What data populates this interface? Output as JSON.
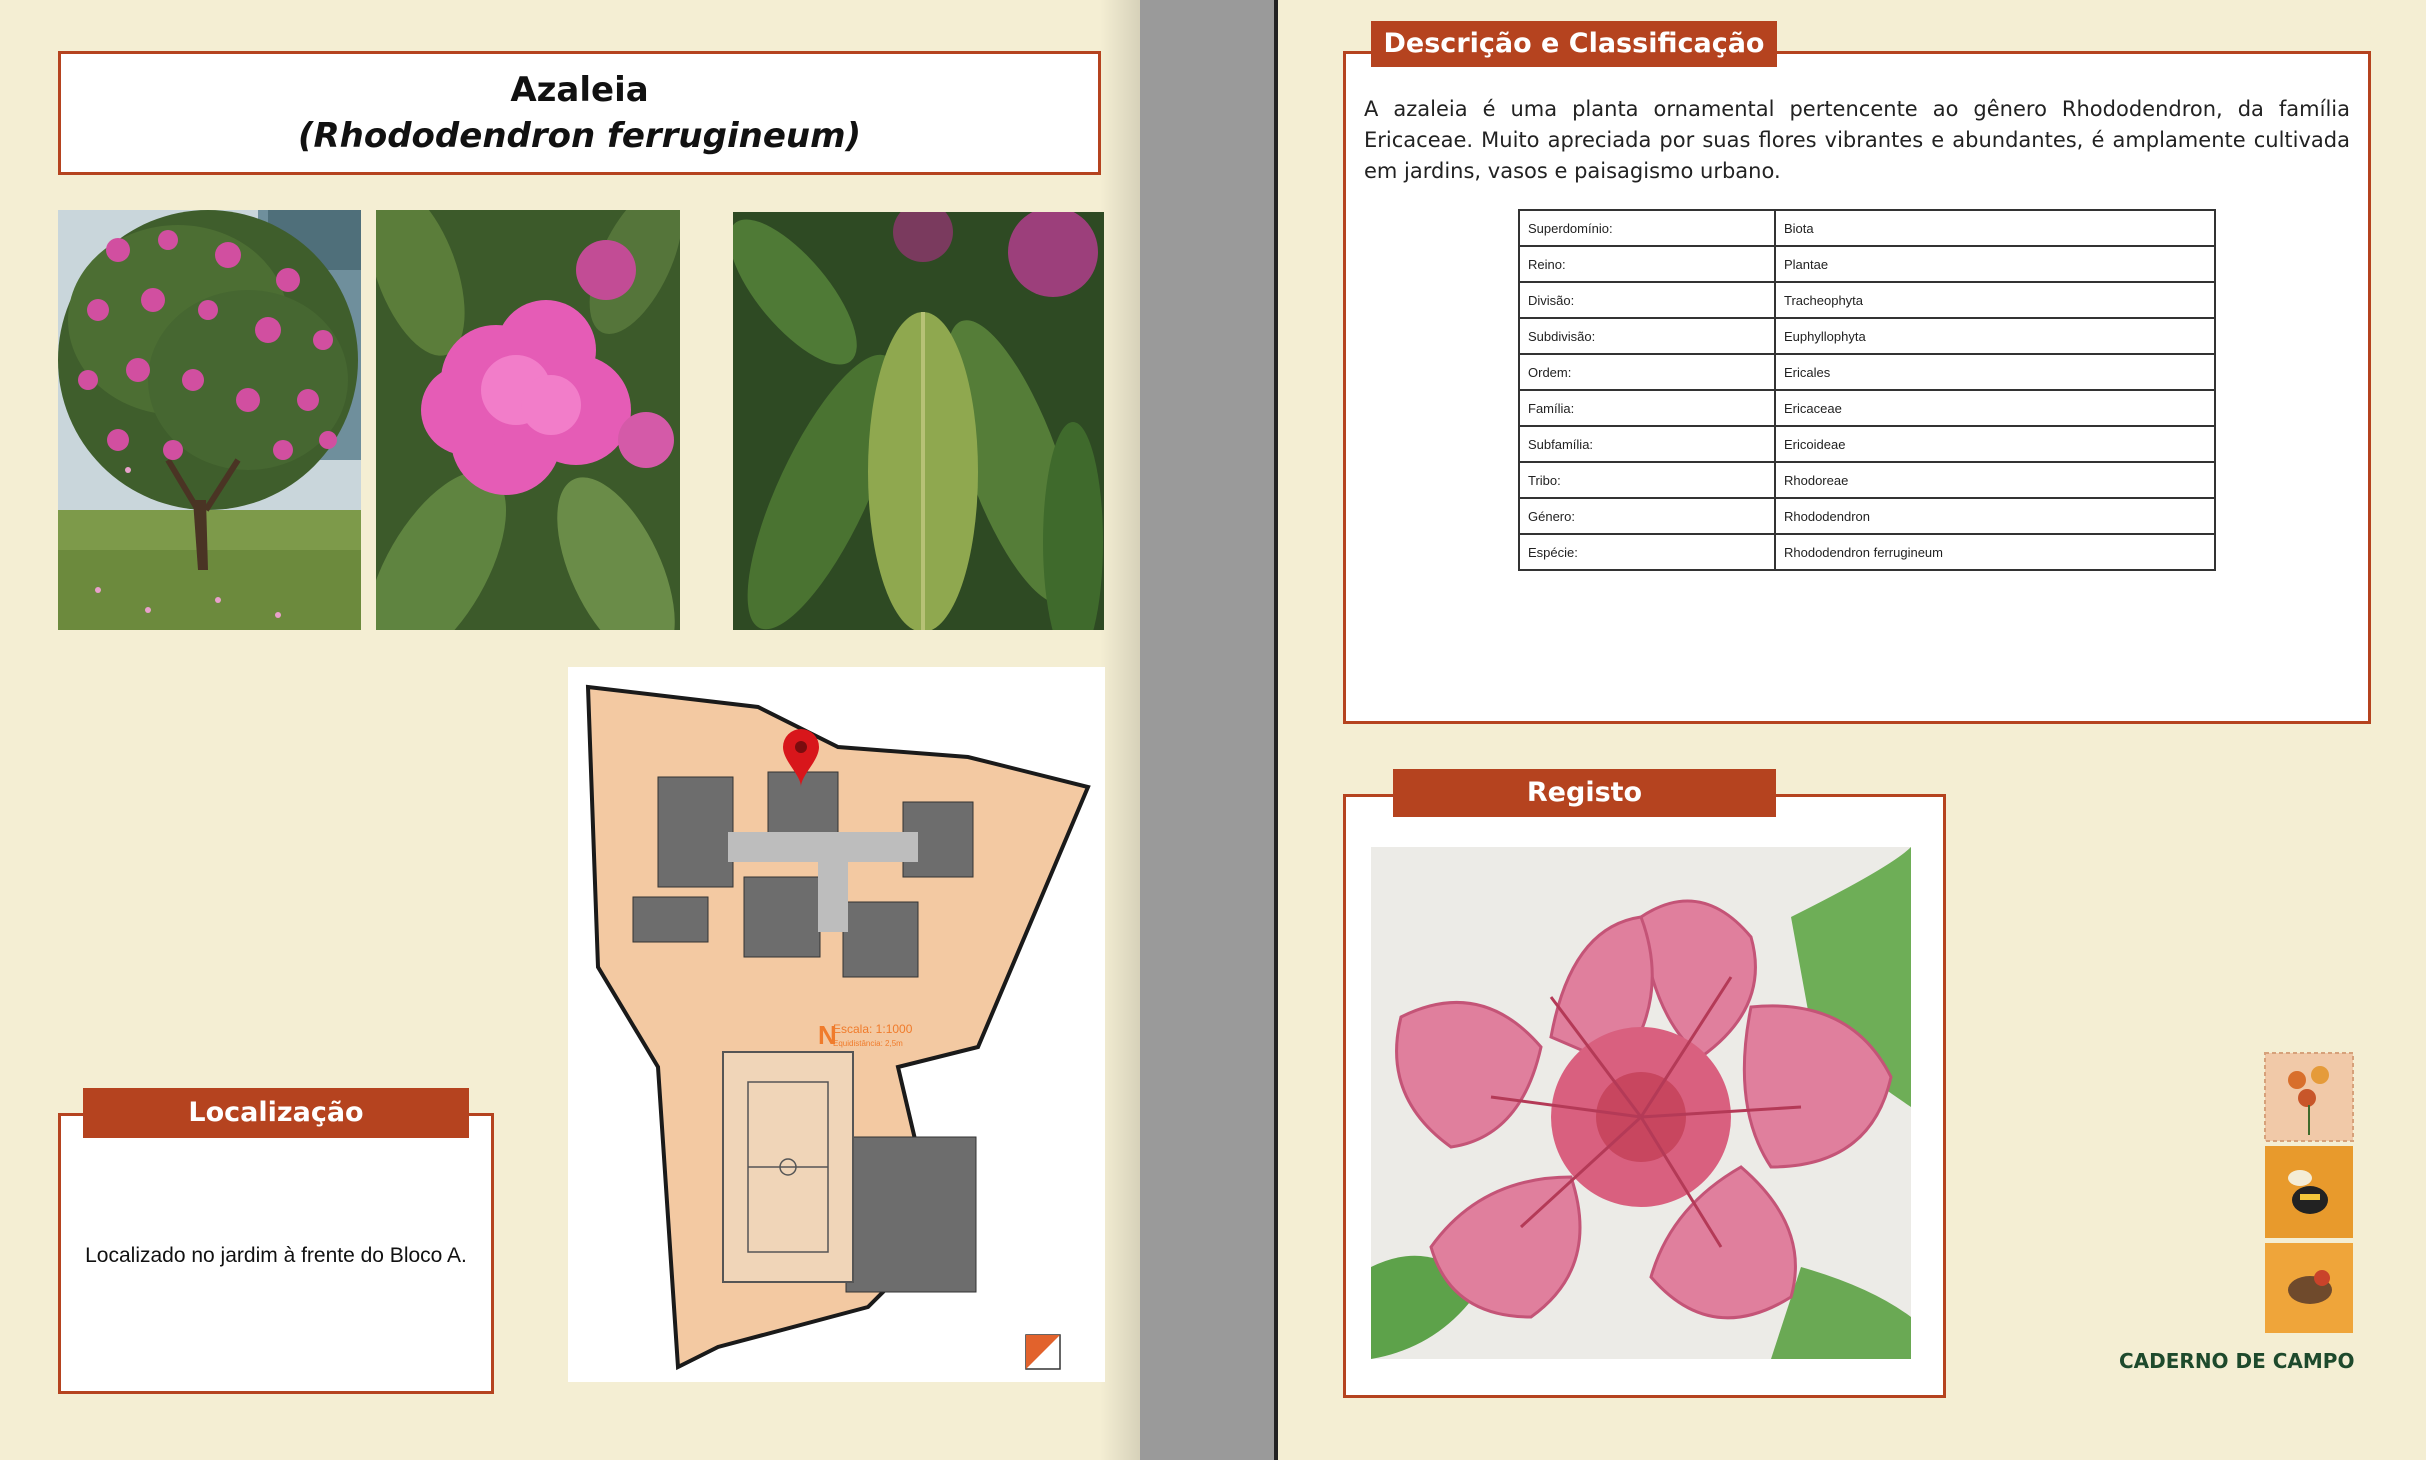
{
  "left_page": {
    "title": "Azaleia",
    "scientific_name": "(Rhododendron ferrugineum)",
    "location": {
      "label": "Localização",
      "text": "Localizado no jardim à frente do Bloco A."
    },
    "map": {
      "scale": "Escala: 1:1000",
      "equidistance": "Equidistância: 2,5m",
      "north": "N"
    }
  },
  "right_page": {
    "description": {
      "label": "Descrição e Classificação",
      "text": "A azaleia é uma planta ornamental pertencente ao gênero Rhododendron, da família Ericaceae. Muito apreciada por suas flores vibrantes e abundantes, é amplamente cultivada em jardins, vasos e paisagismo urbano.",
      "taxonomy": [
        {
          "rank": "Superdomínio:",
          "value": "Biota"
        },
        {
          "rank": "Reino:",
          "value": "Plantae"
        },
        {
          "rank": "Divisão:",
          "value": "Tracheophyta"
        },
        {
          "rank": "Subdivisão:",
          "value": "Euphyllophyta"
        },
        {
          "rank": "Ordem:",
          "value": "Ericales"
        },
        {
          "rank": "Família:",
          "value": "Ericaceae"
        },
        {
          "rank": "Subfamília:",
          "value": "Ericoideae"
        },
        {
          "rank": "Tribo:",
          "value": "Rhodoreae"
        },
        {
          "rank": "Género:",
          "value": "Rhododendron"
        },
        {
          "rank": "Espécie:",
          "value": "Rhododendron ferrugineum"
        }
      ]
    },
    "registo": {
      "label": "Registo"
    },
    "brand": "CADERNO DE CAMPO"
  },
  "colors": {
    "accent": "#b5431f",
    "page": "#f4eed3",
    "brand_text": "#1e4a2c"
  }
}
